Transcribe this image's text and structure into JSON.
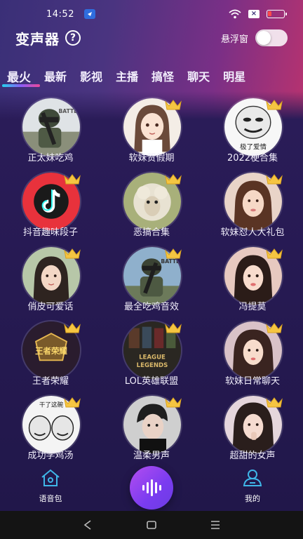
{
  "status": {
    "time": "14:52"
  },
  "header": {
    "title": "变声器",
    "help_glyph": "?",
    "float_label": "悬浮窗",
    "float_enabled": false
  },
  "tabs": [
    {
      "label": "最火",
      "active": true
    },
    {
      "label": "最新",
      "active": false
    },
    {
      "label": "影视",
      "active": false
    },
    {
      "label": "主播",
      "active": false
    },
    {
      "label": "搞怪",
      "active": false
    },
    {
      "label": "聊天",
      "active": false
    },
    {
      "label": "明星",
      "active": false
    }
  ],
  "packs": [
    {
      "label": "正太妹吃鸡",
      "vip": false,
      "icon": "pubg-soldier-avatar"
    },
    {
      "label": "软妹贺假期",
      "vip": true,
      "icon": "anime-girl-avatar"
    },
    {
      "label": "2022梗合集",
      "vip": true,
      "icon": "meme-face-avatar"
    },
    {
      "label": "抖音趣味段子",
      "vip": true,
      "icon": "tiktok-logo-avatar"
    },
    {
      "label": "恶搞合集",
      "vip": true,
      "icon": "sheep-avatar"
    },
    {
      "label": "软妹怼人大礼包",
      "vip": true,
      "icon": "girl-photo-avatar"
    },
    {
      "label": "俏皮可爱话",
      "vip": true,
      "icon": "girl-photo-avatar"
    },
    {
      "label": "最全吃鸡音效",
      "vip": true,
      "icon": "pubg-soldier-avatar"
    },
    {
      "label": "冯提莫",
      "vip": true,
      "icon": "girl-photo-avatar"
    },
    {
      "label": "王者荣耀",
      "vip": true,
      "icon": "game-logo-avatar"
    },
    {
      "label": "LOL英雄联盟",
      "vip": true,
      "icon": "league-logo-avatar"
    },
    {
      "label": "软妹日常聊天",
      "vip": true,
      "icon": "girl-photo-avatar"
    },
    {
      "label": "成功学鸡汤",
      "vip": true,
      "icon": "meme-face-avatar"
    },
    {
      "label": "温柔男声",
      "vip": true,
      "icon": "boy-photo-avatar"
    },
    {
      "label": "超甜的女声",
      "vip": true,
      "icon": "girl-photo-avatar"
    }
  ],
  "avatar_text": {
    "pubg": "BATTLE",
    "meme": "极了爱情",
    "wzry": "王者荣耀",
    "lol_top": "LEAGUE",
    "lol_bottom": "LEGENDS",
    "meme2": "干了这碗"
  },
  "bottom_nav": {
    "left_label": "语音包",
    "right_label": "我的"
  },
  "colors": {
    "accent": "#8b5cf6",
    "vip_gold": "#f5c542"
  }
}
